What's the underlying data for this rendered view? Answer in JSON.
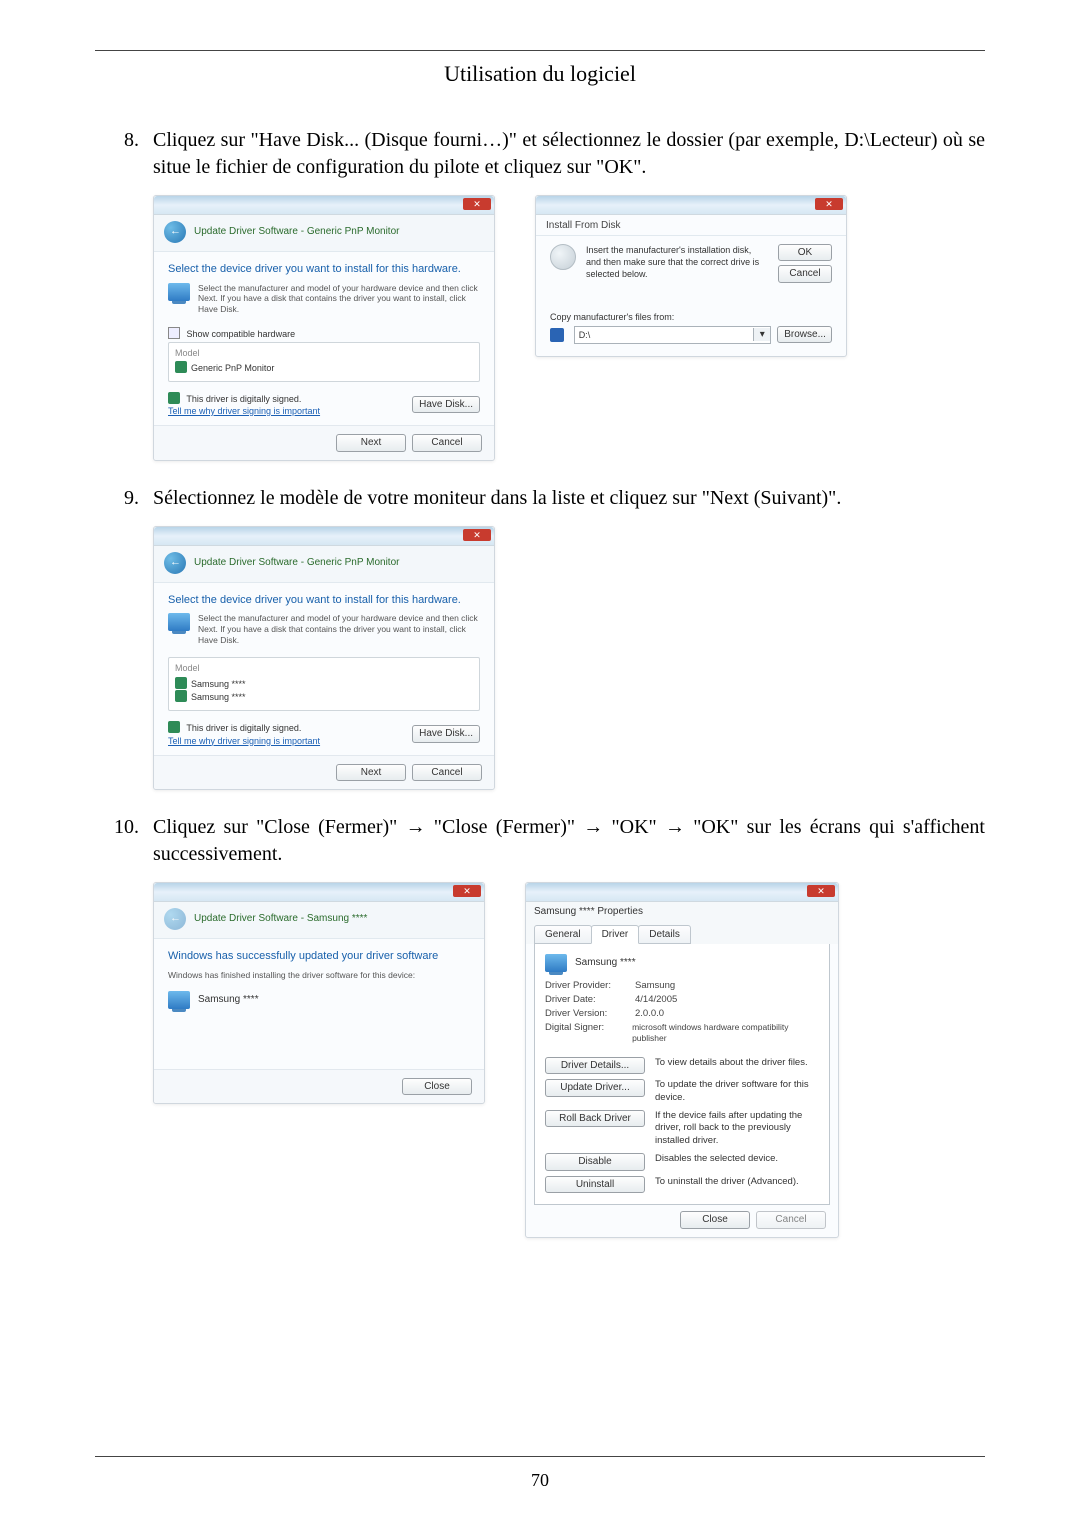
{
  "page": {
    "title": "Utilisation du logiciel",
    "number": "70"
  },
  "steps": {
    "s8": {
      "num": "8.",
      "text": "Cliquez sur \"Have Disk... (Disque fourni…)\" et sélectionnez le dossier (par exemple, D:\\Lecteur) où se situe le fichier de configuration du pilote et cliquez sur \"OK\"."
    },
    "s9": {
      "num": "9.",
      "text": "Sélectionnez le modèle de votre moniteur dans la liste et cliquez sur \"Next (Suivant)\"."
    },
    "s10": {
      "num": "10.",
      "text": "Cliquez sur \"Close (Fermer)\" → \"Close (Fermer)\" → \"OK\" → \"OK\" sur les écrans qui s'affichent successivement."
    }
  },
  "dlg_update1": {
    "title": "Update Driver Software - Generic PnP Monitor",
    "heading": "Select the device driver you want to install for this hardware.",
    "instruction": "Select the manufacturer and model of your hardware device and then click Next. If you have a disk that contains the driver you want to install, click Have Disk.",
    "show_compat": "Show compatible hardware",
    "model_label": "Model",
    "model_item": "Generic PnP Monitor",
    "signed": "This driver is digitally signed.",
    "tell_me": "Tell me why driver signing is important",
    "have_disk": "Have Disk...",
    "next": "Next",
    "cancel": "Cancel"
  },
  "dlg_install_disk": {
    "title": "Install From Disk",
    "instruction": "Insert the manufacturer's installation disk, and then make sure that the correct drive is selected below.",
    "ok": "OK",
    "cancel": "Cancel",
    "copy_label": "Copy manufacturer's files from:",
    "path": "D:\\",
    "browse": "Browse..."
  },
  "dlg_update2": {
    "title": "Update Driver Software - Generic PnP Monitor",
    "heading": "Select the device driver you want to install for this hardware.",
    "instruction": "Select the manufacturer and model of your hardware device and then click Next. If you have a disk that contains the driver you want to install, click Have Disk.",
    "model_label": "Model",
    "model_item1": "Samsung ****",
    "model_item2": "Samsung ****",
    "signed": "This driver is digitally signed.",
    "tell_me": "Tell me why driver signing is important",
    "have_disk": "Have Disk...",
    "next": "Next",
    "cancel": "Cancel"
  },
  "dlg_success": {
    "title": "Update Driver Software - Samsung ****",
    "heading": "Windows has successfully updated your driver software",
    "sub": "Windows has finished installing the driver software for this device:",
    "item": "Samsung ****",
    "close": "Close"
  },
  "dlg_props": {
    "title": "Samsung **** Properties",
    "tabs": {
      "general": "General",
      "driver": "Driver",
      "details": "Details"
    },
    "device": "Samsung ****",
    "kv": {
      "provider_k": "Driver Provider:",
      "provider_v": "Samsung",
      "date_k": "Driver Date:",
      "date_v": "4/14/2005",
      "version_k": "Driver Version:",
      "version_v": "2.0.0.0",
      "signer_k": "Digital Signer:",
      "signer_v": "microsoft windows hardware compatibility publisher"
    },
    "actions": {
      "details_btn": "Driver Details...",
      "details_txt": "To view details about the driver files.",
      "update_btn": "Update Driver...",
      "update_txt": "To update the driver software for this device.",
      "rollback_btn": "Roll Back Driver",
      "rollback_txt": "If the device fails after updating the driver, roll back to the previously installed driver.",
      "disable_btn": "Disable",
      "disable_txt": "Disables the selected device.",
      "uninstall_btn": "Uninstall",
      "uninstall_txt": "To uninstall the driver (Advanced)."
    },
    "close": "Close",
    "cancel": "Cancel"
  }
}
